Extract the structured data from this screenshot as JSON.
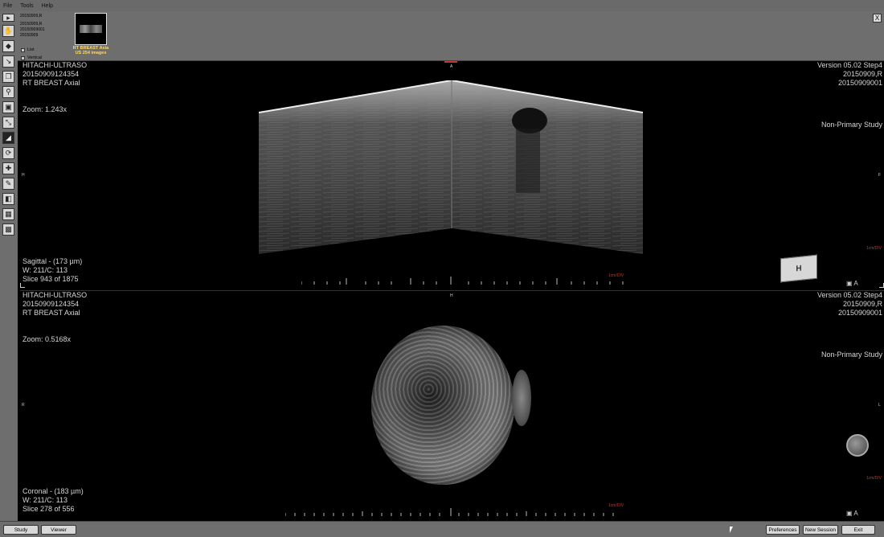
{
  "menu": {
    "file": "File",
    "tools": "Tools",
    "help": "Help"
  },
  "study": {
    "line1": "20150909,R",
    "line2": "20150909,R",
    "line3": "20150909001",
    "line4": "20150909",
    "thumb_caption_1": "RT BREAST Axia",
    "thumb_caption_2": "US 254 images",
    "list_label": "List",
    "vertical_label": "Vertical",
    "close": "X"
  },
  "top_pane": {
    "device": "HITACHI-ULTRASO",
    "study_id": "20150909124354",
    "series": "RT BREAST Axial",
    "zoom": "Zoom: 1.243x",
    "version": "Version 05.02 Step4",
    "patient": "20150909,R",
    "accession": "20150909001",
    "study_type": "Non-Primary Study",
    "plane": "Sagittal - (173 µm)",
    "window": "W: 211/C: 113",
    "slice": "Slice 943 of 1875",
    "scale_label": "1cm/DIV",
    "scale_label_right": "1cm/DIV",
    "orient_top": "A",
    "orient_left": "H",
    "orient_right": "F",
    "orient_bottom": "H",
    "corner_label": "A"
  },
  "bottom_pane": {
    "device": "HITACHI-ULTRASO",
    "study_id": "20150909124354",
    "series": "RT BREAST Axial",
    "zoom": "Zoom: 0.5168x",
    "version": "Version 05.02 Step4",
    "patient": "20150909,R",
    "accession": "20150909001",
    "study_type": "Non-Primary Study",
    "plane": "Coronal - (183 µm)",
    "window": "W: 211/C: 113",
    "slice": "Slice 278 of 556",
    "scale_label": "1cm/DIV",
    "scale_label_right": "1cm/DIV",
    "orient_left": "R",
    "orient_right": "L",
    "corner_label": "A"
  },
  "buttons": {
    "study": "Study",
    "viewer": "Viewer",
    "preferences": "Preferences",
    "new_session": "New Session",
    "exit": "Exit"
  },
  "icons": [
    "pan-hand-icon",
    "fill-icon",
    "arrow-icon",
    "copy-icon",
    "zoom-icon",
    "zoom-fit-icon",
    "measure-icon",
    "contrast-icon",
    "rotate-icon",
    "move-icon",
    "ruler-icon",
    "window-level-icon",
    "grid-icon",
    "cube-icon"
  ]
}
